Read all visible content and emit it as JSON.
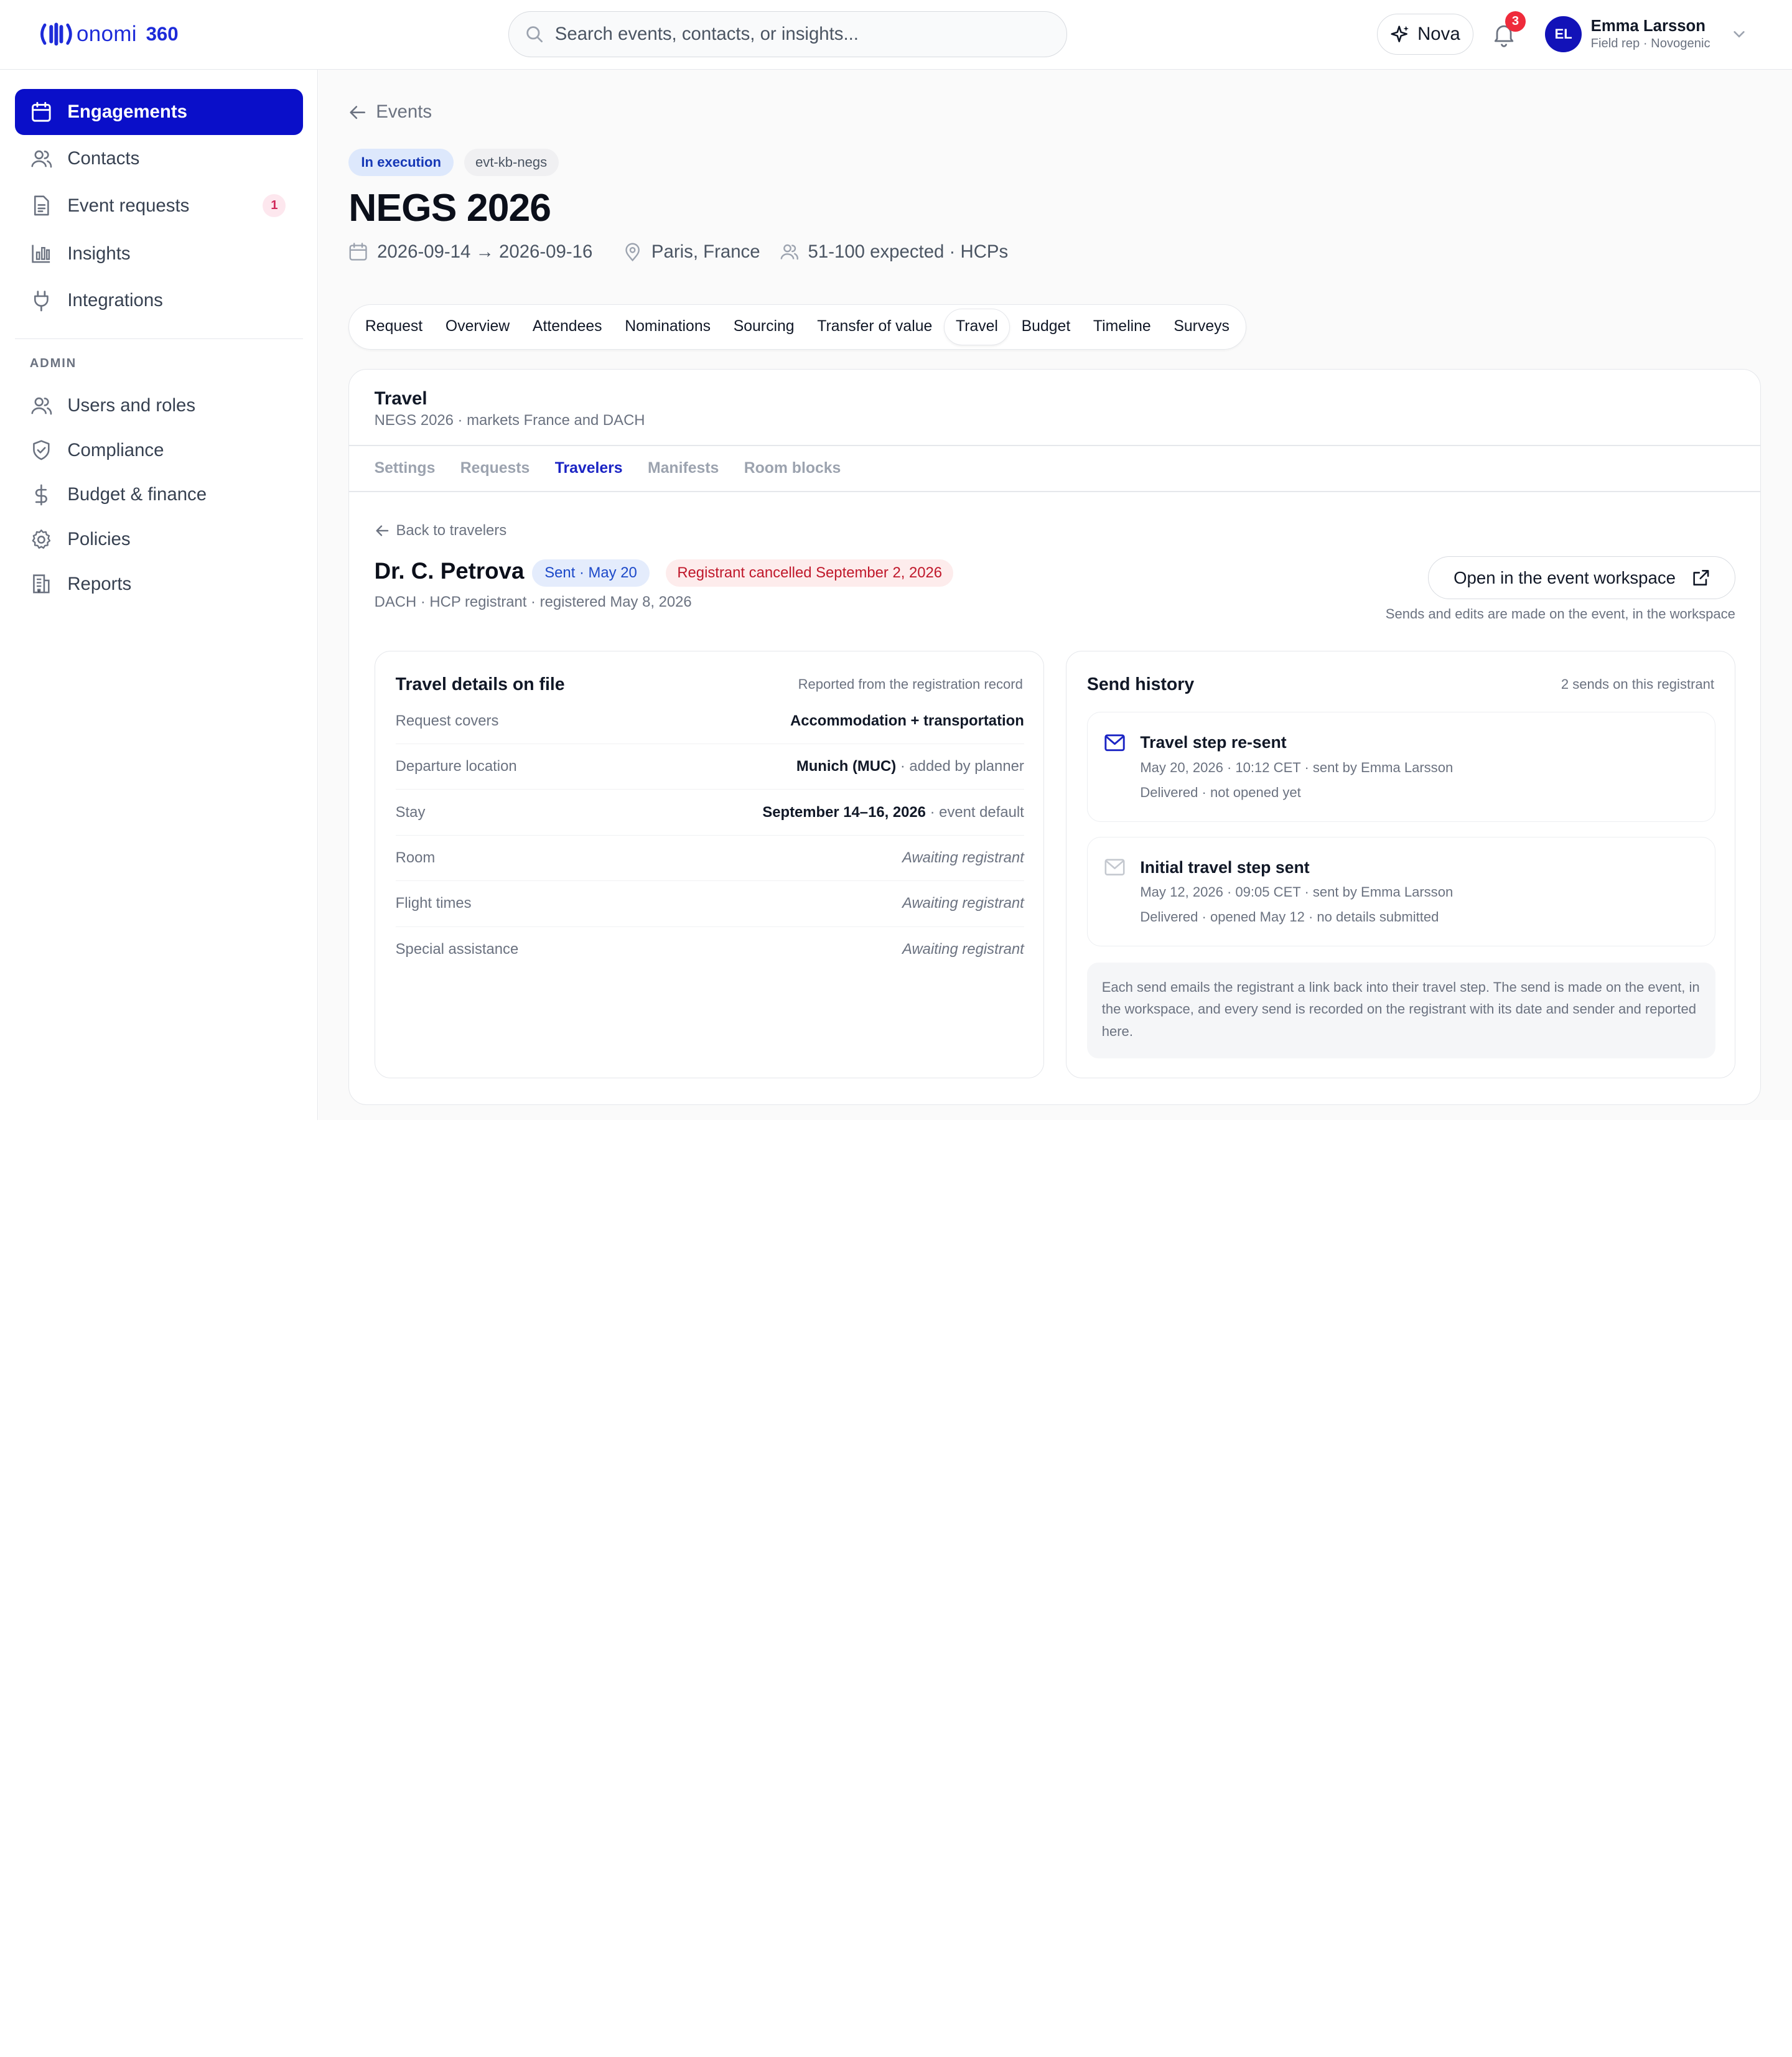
{
  "brand": {
    "name": "onomi",
    "suffix": "360",
    "color": "#1d2bd9"
  },
  "search": {
    "placeholder": "Search events, contacts, or insights..."
  },
  "header": {
    "nova_label": "Nova",
    "notifications_count": "3",
    "user": {
      "initials": "EL",
      "name": "Emma Larsson",
      "role": "Field rep · Novogenic"
    }
  },
  "sidebar": {
    "items": [
      {
        "label": "Engagements",
        "icon": "calendar-icon",
        "active": true
      },
      {
        "label": "Contacts",
        "icon": "users-icon"
      },
      {
        "label": "Event requests",
        "icon": "document-icon",
        "badge": "1"
      },
      {
        "label": "Insights",
        "icon": "bar-chart-icon"
      },
      {
        "label": "Integrations",
        "icon": "plug-icon"
      }
    ],
    "admin_label": "ADMIN",
    "admin_items": [
      {
        "label": "Users and roles",
        "icon": "users-icon"
      },
      {
        "label": "Compliance",
        "icon": "shield-icon"
      },
      {
        "label": "Budget & finance",
        "icon": "dollar-icon"
      },
      {
        "label": "Policies",
        "icon": "gear-icon"
      },
      {
        "label": "Reports",
        "icon": "building-icon"
      }
    ]
  },
  "event": {
    "back_label": "Events",
    "status": "In execution",
    "code": "evt-kb-negs",
    "title": "NEGS 2026",
    "dates": "2026-09-14 → 2026-09-16",
    "location": "Paris, France",
    "attendance": "51-100 expected · HCPs"
  },
  "tabs": [
    "Request",
    "Overview",
    "Attendees",
    "Nominations",
    "Sourcing",
    "Transfer of value",
    "Travel",
    "Budget",
    "Timeline",
    "Surveys"
  ],
  "active_tab": "Travel",
  "travel": {
    "title": "Travel",
    "subtitle": "NEGS 2026 · markets France and DACH",
    "subtabs": [
      "Settings",
      "Requests",
      "Travelers",
      "Manifests",
      "Room blocks"
    ],
    "active_subtab": "Travelers",
    "back_label": "Back to travelers"
  },
  "registrant": {
    "name": "Dr. C. Petrova",
    "sent_badge": "Sent · May 20",
    "cancel_badge": "Registrant cancelled September 2, 2026",
    "meta": "DACH · HCP registrant · registered May 8, 2026",
    "open_button": "Open in the event workspace",
    "workspace_note": "Sends and edits are made on the event, in the workspace"
  },
  "details": {
    "title": "Travel details on file",
    "note": "Reported from the registration record",
    "rows": [
      {
        "label": "Request covers",
        "value": "Accommodation + transportation",
        "suffix": ""
      },
      {
        "label": "Departure location",
        "value": "Munich (MUC)",
        "suffix": " · added by planner"
      },
      {
        "label": "Stay",
        "value": "September 14–16, 2026",
        "suffix": " · event default"
      },
      {
        "label": "Room",
        "muted": "Awaiting registrant"
      },
      {
        "label": "Flight times",
        "muted": "Awaiting registrant"
      },
      {
        "label": "Special assistance",
        "muted": "Awaiting registrant"
      }
    ]
  },
  "history": {
    "title": "Send history",
    "note": "2 sends on this registrant",
    "items": [
      {
        "title": "Travel step re-sent",
        "line1": "May 20, 2026 · 10:12 CET · sent by Emma Larsson",
        "line2": "Delivered · not opened yet",
        "icon": "mail-icon"
      },
      {
        "title": "Initial travel step sent",
        "line1": "May 12, 2026 · 09:05 CET · sent by Emma Larsson",
        "line2": "Delivered · opened May 12 · no details submitted",
        "icon": "mail-icon"
      }
    ],
    "info": "Each send emails the registrant a link back into their travel step. The send is made on the event, in the workspace, and every send is recorded on the registrant with its date and sender and reported here."
  }
}
